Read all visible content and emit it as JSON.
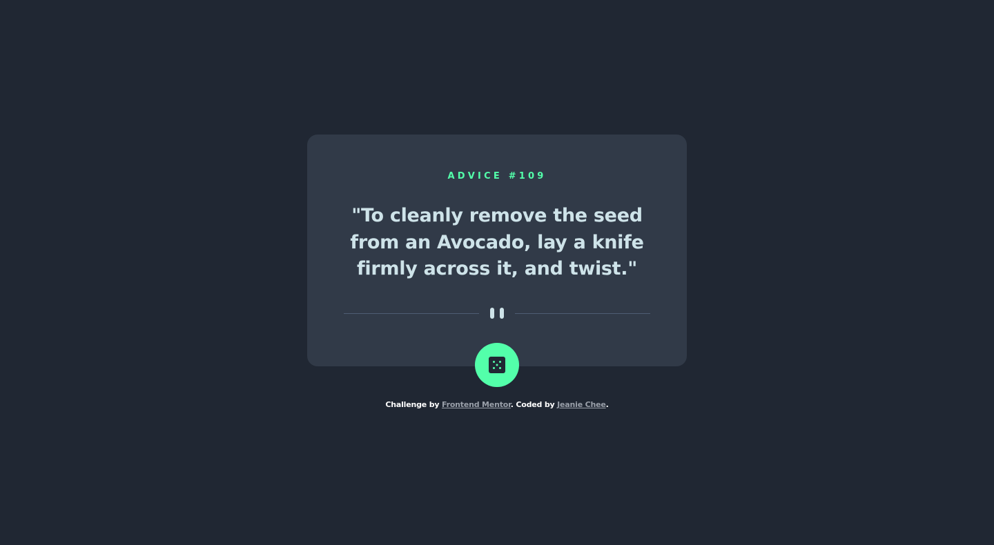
{
  "card": {
    "advice_label": "ADVICE #109",
    "advice_text": "\"To cleanly remove the seed from an Avocado, lay a knife firmly across it, and twist.\""
  },
  "divider": {
    "icon": "pause-icon"
  },
  "generate_button": {
    "icon": "dice-icon"
  },
  "attribution": {
    "challenge_prefix": "Challenge by ",
    "challenge_link": "Frontend Mentor",
    "coded_prefix": ". Coded by ",
    "coded_link": "Jeanie Chee",
    "suffix": "."
  },
  "colors": {
    "background": "#202733",
    "card": "#313A48",
    "accent": "#53FFAA",
    "text": "#CEE3E9",
    "divider": "#4F5D74"
  }
}
